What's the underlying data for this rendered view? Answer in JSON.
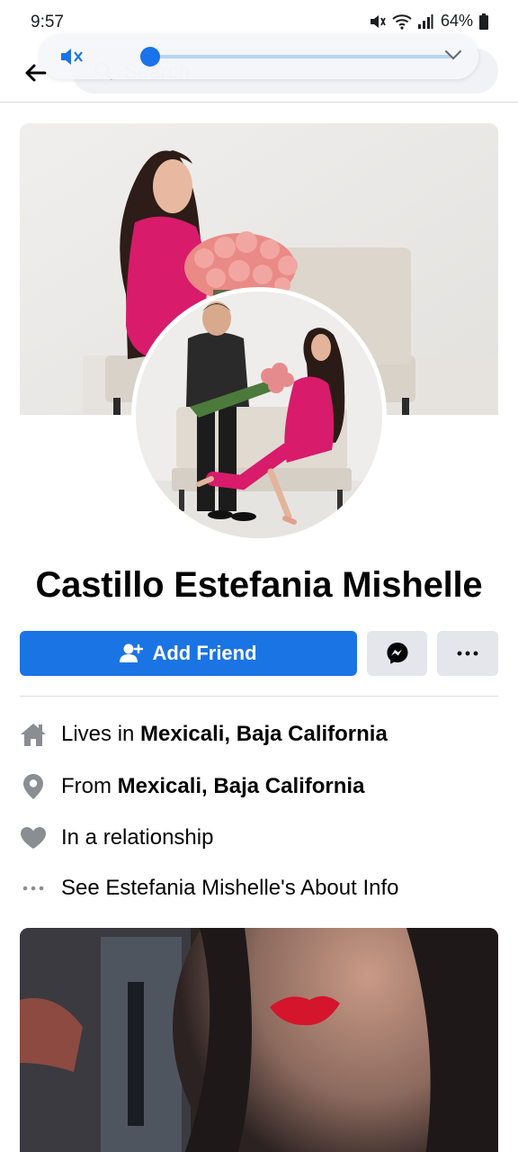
{
  "status_bar": {
    "time": "9:57",
    "battery": "64%",
    "icons": [
      "mute-icon",
      "wifi-icon",
      "signal-icon",
      "battery-icon"
    ]
  },
  "header": {
    "search_placeholder": "Search",
    "icons": [
      "back-arrow-icon",
      "search-icon"
    ]
  },
  "volume_overlay": {
    "level": 0,
    "icons": [
      "muted-speaker-icon",
      "chevron-down-icon"
    ]
  },
  "profile": {
    "name": "Castillo Estefania Mishelle"
  },
  "actions": {
    "add_friend_label": "Add Friend",
    "icons": [
      "add-friend-icon",
      "messenger-icon",
      "more-icon"
    ]
  },
  "intro": {
    "lives_prefix": "Lives in ",
    "lives_place": "Mexicali, Baja California",
    "from_prefix": "From ",
    "from_place": "Mexicali, Baja California",
    "relationship": "In a relationship",
    "about_link": "See Estefania Mishelle's About Info",
    "icons": [
      "home-icon",
      "location-pin-icon",
      "heart-icon",
      "more-dots-icon"
    ]
  },
  "colors": {
    "primary_blue": "#1b74e4",
    "secondary_button": "#e4e6eb",
    "icon_gray": "#8a8d91",
    "dress_pink": "#d81b6a"
  }
}
